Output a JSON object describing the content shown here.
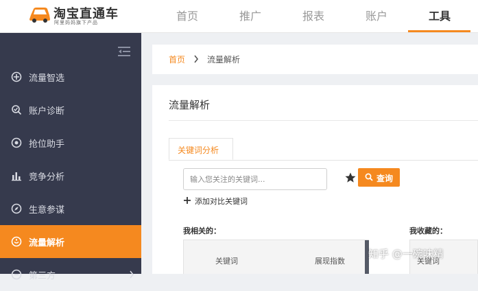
{
  "brand": {
    "title": "淘宝直通车",
    "subtitle": "阿里妈妈旗下产品"
  },
  "nav": {
    "items": [
      {
        "label": "首页"
      },
      {
        "label": "推广"
      },
      {
        "label": "报表"
      },
      {
        "label": "账户"
      },
      {
        "label": "工具",
        "active": true
      }
    ]
  },
  "sidebar": {
    "items": [
      {
        "label": "流量智选",
        "icon": "compass-icon"
      },
      {
        "label": "账户诊断",
        "icon": "diagnosis-icon"
      },
      {
        "label": "抢位助手",
        "icon": "target-icon"
      },
      {
        "label": "竞争分析",
        "icon": "bar-chart-icon"
      },
      {
        "label": "生意参谋",
        "icon": "compass-needle-icon"
      },
      {
        "label": "流量解析",
        "icon": "traffic-icon",
        "active": true
      },
      {
        "label": "第三方",
        "icon": "third-party-icon"
      }
    ]
  },
  "breadcrumb": {
    "home": "首页",
    "current": "流量解析"
  },
  "main": {
    "title": "流量解析",
    "tab_label": "关键词分析",
    "search_placeholder": "输入您关注的关键词...",
    "search_value": "",
    "query_label": "查询",
    "add_compare_label": "添加对比关键词",
    "related_label": "我相关的：",
    "favorites_label": "我收藏的：",
    "table_columns": [
      "关键词",
      "展现指数"
    ],
    "favorites_column": "关键词"
  },
  "watermark": "知乎 @一碗味精",
  "colors": {
    "accent": "#f5891f",
    "sidebar_bg": "#363a4d",
    "page_bg": "#eef0f3"
  }
}
